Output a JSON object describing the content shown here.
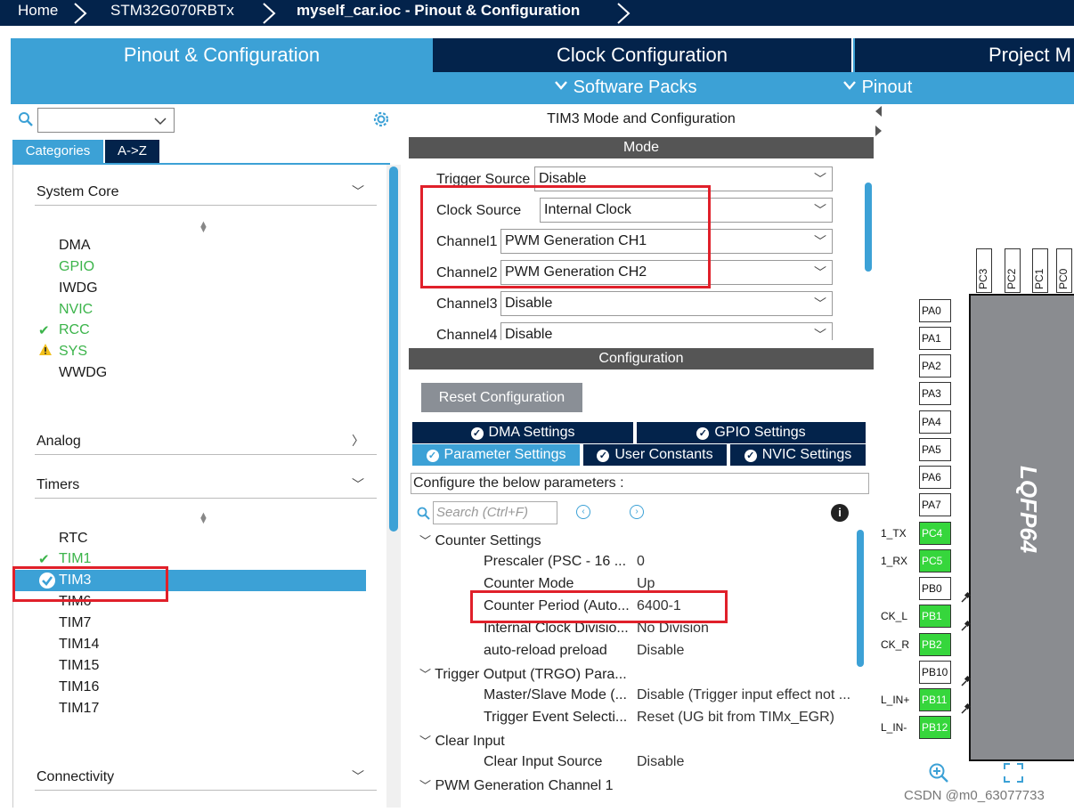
{
  "breadcrumb": {
    "home": "Home",
    "device": "STM32G070RBTx",
    "file": "myself_car.ioc - Pinout & Configuration"
  },
  "main_tabs": [
    "Pinout & Configuration",
    "Clock Configuration",
    "Project M"
  ],
  "sub_menu": {
    "software_packs": "Software Packs",
    "pinout": "Pinout"
  },
  "left": {
    "search_value": "",
    "tab_categories": "Categories",
    "tab_az": "A->Z",
    "groups": {
      "system_core": "System Core",
      "analog": "Analog",
      "timers": "Timers",
      "connectivity": "Connectivity"
    },
    "system_core_items": [
      "DMA",
      "GPIO",
      "IWDG",
      "NVIC",
      "RCC",
      "SYS",
      "WWDG"
    ],
    "timer_items": [
      "RTC",
      "TIM1",
      "TIM3",
      "TIM6",
      "TIM7",
      "TIM14",
      "TIM15",
      "TIM16",
      "TIM17"
    ],
    "selected_item": "TIM3"
  },
  "mid": {
    "title": "TIM3 Mode and Configuration",
    "mode_bar": "Mode",
    "mode_rows": [
      {
        "label": "Trigger Source",
        "value": "Disable"
      },
      {
        "label": "Clock Source",
        "value": "Internal Clock"
      },
      {
        "label": "Channel1",
        "value": "PWM Generation CH1"
      },
      {
        "label": "Channel2",
        "value": "PWM Generation CH2"
      },
      {
        "label": "Channel3",
        "value": "Disable"
      },
      {
        "label": "Channel4",
        "value": "Disable"
      }
    ],
    "config_bar": "Configuration",
    "reset_button": "Reset Configuration",
    "tabs_row1": [
      "DMA Settings",
      "GPIO Settings"
    ],
    "tabs_row2": [
      "Parameter Settings",
      "User Constants",
      "NVIC Settings"
    ],
    "hint": "Configure the below parameters :",
    "search_placeholder": "Search (Ctrl+F)",
    "tree": {
      "counter_settings": "Counter Settings",
      "counter_rows": [
        {
          "key": "Prescaler (PSC - 16 ...",
          "value": "0"
        },
        {
          "key": "Counter Mode",
          "value": "Up"
        },
        {
          "key": "Counter Period (Auto...",
          "value": "6400-1"
        },
        {
          "key": "Internal Clock Divisio...",
          "value": "No Division"
        },
        {
          "key": "auto-reload preload",
          "value": "Disable"
        }
      ],
      "trgo": "Trigger Output (TRGO) Para...",
      "trgo_rows": [
        {
          "key": "Master/Slave Mode (...",
          "value": "Disable (Trigger input effect not ..."
        },
        {
          "key": "Trigger Event Selecti...",
          "value": "Reset (UG bit from TIMx_EGR)"
        }
      ],
      "clear_input": "Clear Input",
      "clear_rows": [
        {
          "key": "Clear Input Source",
          "value": "Disable"
        }
      ],
      "pwm_ch1": "PWM Generation Channel 1"
    }
  },
  "right": {
    "chip_label": "LQFP64",
    "top_pins": [
      "PC3",
      "PC2",
      "PC1",
      "PC0"
    ],
    "left_pins": [
      {
        "name": "PA0",
        "signal": "",
        "active": false
      },
      {
        "name": "PA1",
        "signal": "",
        "active": false
      },
      {
        "name": "PA2",
        "signal": "",
        "active": false
      },
      {
        "name": "PA3",
        "signal": "",
        "active": false
      },
      {
        "name": "PA4",
        "signal": "",
        "active": false
      },
      {
        "name": "PA5",
        "signal": "",
        "active": false
      },
      {
        "name": "PA6",
        "signal": "",
        "active": false
      },
      {
        "name": "PA7",
        "signal": "",
        "active": false
      },
      {
        "name": "PC4",
        "signal": "1_TX",
        "active": true
      },
      {
        "name": "PC5",
        "signal": "1_RX",
        "active": true
      },
      {
        "name": "PB0",
        "signal": "",
        "active": false
      },
      {
        "name": "PB1",
        "signal": "CK_L",
        "active": true
      },
      {
        "name": "PB2",
        "signal": "CK_R",
        "active": true
      },
      {
        "name": "PB10",
        "signal": "",
        "active": false
      },
      {
        "name": "PB11",
        "signal": "L_IN+",
        "active": true
      },
      {
        "name": "PB12",
        "signal": "L_IN-",
        "active": true
      }
    ]
  },
  "watermark": "CSDN @m0_63077733",
  "colors": {
    "navy": "#03234b",
    "accent": "#3ca1d6",
    "green": "#36d63c",
    "highlight_red": "#e0202a"
  }
}
